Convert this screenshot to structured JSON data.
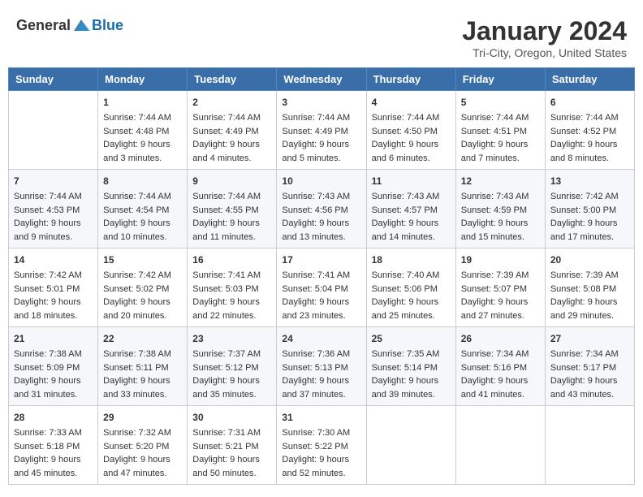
{
  "logo": {
    "general": "General",
    "blue": "Blue"
  },
  "header": {
    "title": "January 2024",
    "subtitle": "Tri-City, Oregon, United States"
  },
  "weekdays": [
    "Sunday",
    "Monday",
    "Tuesday",
    "Wednesday",
    "Thursday",
    "Friday",
    "Saturday"
  ],
  "weeks": [
    [
      {
        "day": "",
        "sunrise": "",
        "sunset": "",
        "daylight": ""
      },
      {
        "day": "1",
        "sunrise": "Sunrise: 7:44 AM",
        "sunset": "Sunset: 4:48 PM",
        "daylight": "Daylight: 9 hours and 3 minutes."
      },
      {
        "day": "2",
        "sunrise": "Sunrise: 7:44 AM",
        "sunset": "Sunset: 4:49 PM",
        "daylight": "Daylight: 9 hours and 4 minutes."
      },
      {
        "day": "3",
        "sunrise": "Sunrise: 7:44 AM",
        "sunset": "Sunset: 4:49 PM",
        "daylight": "Daylight: 9 hours and 5 minutes."
      },
      {
        "day": "4",
        "sunrise": "Sunrise: 7:44 AM",
        "sunset": "Sunset: 4:50 PM",
        "daylight": "Daylight: 9 hours and 6 minutes."
      },
      {
        "day": "5",
        "sunrise": "Sunrise: 7:44 AM",
        "sunset": "Sunset: 4:51 PM",
        "daylight": "Daylight: 9 hours and 7 minutes."
      },
      {
        "day": "6",
        "sunrise": "Sunrise: 7:44 AM",
        "sunset": "Sunset: 4:52 PM",
        "daylight": "Daylight: 9 hours and 8 minutes."
      }
    ],
    [
      {
        "day": "7",
        "sunrise": "Sunrise: 7:44 AM",
        "sunset": "Sunset: 4:53 PM",
        "daylight": "Daylight: 9 hours and 9 minutes."
      },
      {
        "day": "8",
        "sunrise": "Sunrise: 7:44 AM",
        "sunset": "Sunset: 4:54 PM",
        "daylight": "Daylight: 9 hours and 10 minutes."
      },
      {
        "day": "9",
        "sunrise": "Sunrise: 7:44 AM",
        "sunset": "Sunset: 4:55 PM",
        "daylight": "Daylight: 9 hours and 11 minutes."
      },
      {
        "day": "10",
        "sunrise": "Sunrise: 7:43 AM",
        "sunset": "Sunset: 4:56 PM",
        "daylight": "Daylight: 9 hours and 13 minutes."
      },
      {
        "day": "11",
        "sunrise": "Sunrise: 7:43 AM",
        "sunset": "Sunset: 4:57 PM",
        "daylight": "Daylight: 9 hours and 14 minutes."
      },
      {
        "day": "12",
        "sunrise": "Sunrise: 7:43 AM",
        "sunset": "Sunset: 4:59 PM",
        "daylight": "Daylight: 9 hours and 15 minutes."
      },
      {
        "day": "13",
        "sunrise": "Sunrise: 7:42 AM",
        "sunset": "Sunset: 5:00 PM",
        "daylight": "Daylight: 9 hours and 17 minutes."
      }
    ],
    [
      {
        "day": "14",
        "sunrise": "Sunrise: 7:42 AM",
        "sunset": "Sunset: 5:01 PM",
        "daylight": "Daylight: 9 hours and 18 minutes."
      },
      {
        "day": "15",
        "sunrise": "Sunrise: 7:42 AM",
        "sunset": "Sunset: 5:02 PM",
        "daylight": "Daylight: 9 hours and 20 minutes."
      },
      {
        "day": "16",
        "sunrise": "Sunrise: 7:41 AM",
        "sunset": "Sunset: 5:03 PM",
        "daylight": "Daylight: 9 hours and 22 minutes."
      },
      {
        "day": "17",
        "sunrise": "Sunrise: 7:41 AM",
        "sunset": "Sunset: 5:04 PM",
        "daylight": "Daylight: 9 hours and 23 minutes."
      },
      {
        "day": "18",
        "sunrise": "Sunrise: 7:40 AM",
        "sunset": "Sunset: 5:06 PM",
        "daylight": "Daylight: 9 hours and 25 minutes."
      },
      {
        "day": "19",
        "sunrise": "Sunrise: 7:39 AM",
        "sunset": "Sunset: 5:07 PM",
        "daylight": "Daylight: 9 hours and 27 minutes."
      },
      {
        "day": "20",
        "sunrise": "Sunrise: 7:39 AM",
        "sunset": "Sunset: 5:08 PM",
        "daylight": "Daylight: 9 hours and 29 minutes."
      }
    ],
    [
      {
        "day": "21",
        "sunrise": "Sunrise: 7:38 AM",
        "sunset": "Sunset: 5:09 PM",
        "daylight": "Daylight: 9 hours and 31 minutes."
      },
      {
        "day": "22",
        "sunrise": "Sunrise: 7:38 AM",
        "sunset": "Sunset: 5:11 PM",
        "daylight": "Daylight: 9 hours and 33 minutes."
      },
      {
        "day": "23",
        "sunrise": "Sunrise: 7:37 AM",
        "sunset": "Sunset: 5:12 PM",
        "daylight": "Daylight: 9 hours and 35 minutes."
      },
      {
        "day": "24",
        "sunrise": "Sunrise: 7:36 AM",
        "sunset": "Sunset: 5:13 PM",
        "daylight": "Daylight: 9 hours and 37 minutes."
      },
      {
        "day": "25",
        "sunrise": "Sunrise: 7:35 AM",
        "sunset": "Sunset: 5:14 PM",
        "daylight": "Daylight: 9 hours and 39 minutes."
      },
      {
        "day": "26",
        "sunrise": "Sunrise: 7:34 AM",
        "sunset": "Sunset: 5:16 PM",
        "daylight": "Daylight: 9 hours and 41 minutes."
      },
      {
        "day": "27",
        "sunrise": "Sunrise: 7:34 AM",
        "sunset": "Sunset: 5:17 PM",
        "daylight": "Daylight: 9 hours and 43 minutes."
      }
    ],
    [
      {
        "day": "28",
        "sunrise": "Sunrise: 7:33 AM",
        "sunset": "Sunset: 5:18 PM",
        "daylight": "Daylight: 9 hours and 45 minutes."
      },
      {
        "day": "29",
        "sunrise": "Sunrise: 7:32 AM",
        "sunset": "Sunset: 5:20 PM",
        "daylight": "Daylight: 9 hours and 47 minutes."
      },
      {
        "day": "30",
        "sunrise": "Sunrise: 7:31 AM",
        "sunset": "Sunset: 5:21 PM",
        "daylight": "Daylight: 9 hours and 50 minutes."
      },
      {
        "day": "31",
        "sunrise": "Sunrise: 7:30 AM",
        "sunset": "Sunset: 5:22 PM",
        "daylight": "Daylight: 9 hours and 52 minutes."
      },
      {
        "day": "",
        "sunrise": "",
        "sunset": "",
        "daylight": ""
      },
      {
        "day": "",
        "sunrise": "",
        "sunset": "",
        "daylight": ""
      },
      {
        "day": "",
        "sunrise": "",
        "sunset": "",
        "daylight": ""
      }
    ]
  ]
}
